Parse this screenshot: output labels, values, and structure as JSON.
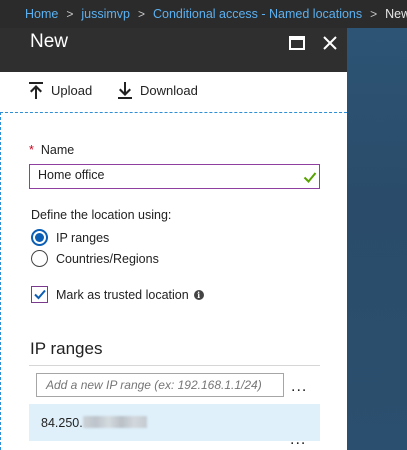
{
  "breadcrumb": {
    "items": [
      "Home",
      "jussimvp",
      "Conditional access - Named locations"
    ],
    "current": "New",
    "separator": ">"
  },
  "blade": {
    "title": "New",
    "toolbar": {
      "upload_label": "Upload",
      "download_label": "Download"
    },
    "name_field": {
      "required_marker": "*",
      "label": "Name",
      "value": "Home office"
    },
    "define_label": "Define the location using:",
    "location_options": [
      {
        "label": "IP ranges",
        "selected": true
      },
      {
        "label": "Countries/Regions",
        "selected": false
      }
    ],
    "trusted": {
      "label": "Mark as trusted location",
      "checked": true
    },
    "ip_section": {
      "title": "IP ranges",
      "placeholder": "Add a new IP range (ex: 192.168.1.1/24)",
      "more": "...",
      "ranges": [
        {
          "value": "84.250."
        }
      ]
    }
  },
  "colors": {
    "accent": "#0a5fb4",
    "link": "#5cb0f0",
    "header_bg": "#2f2f2f",
    "input_border_active": "#8e3fa0",
    "valid_check": "#57a300",
    "selected_row": "#dff0fb"
  },
  "icons": [
    "upload-icon",
    "download-icon",
    "maximize-icon",
    "close-icon",
    "checkmark-icon",
    "info-icon",
    "ellipsis-icon"
  ]
}
